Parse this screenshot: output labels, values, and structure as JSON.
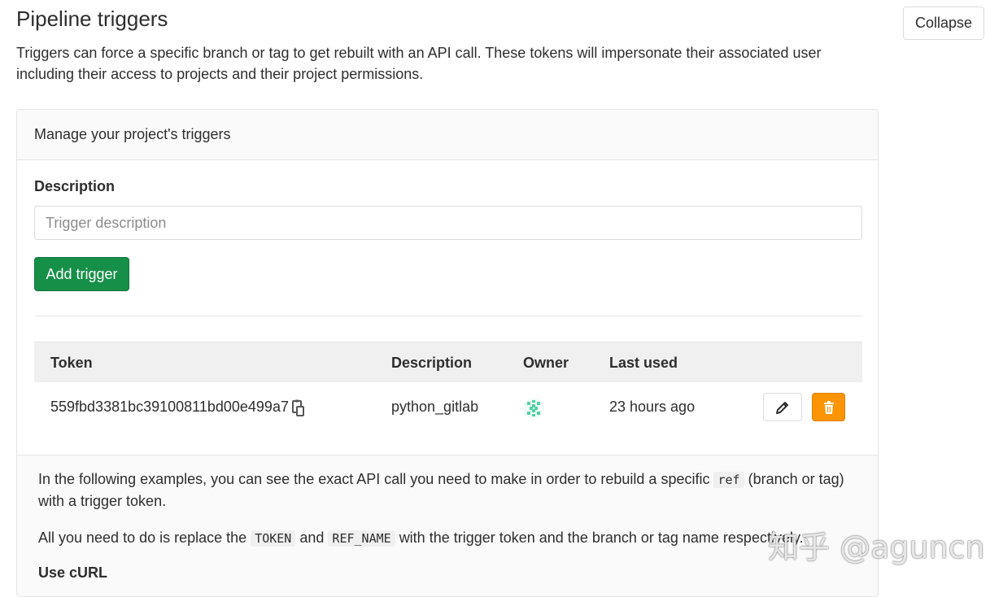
{
  "page": {
    "title": "Pipeline triggers",
    "collapse_label": "Collapse",
    "intro": "Triggers can force a specific branch or tag to get rebuilt with an API call. These tokens will impersonate their associated user including their access to projects and their project permissions."
  },
  "card": {
    "header": "Manage your project's triggers",
    "description_label": "Description",
    "description_placeholder": "Trigger description",
    "description_value": "",
    "add_button": "Add trigger"
  },
  "table": {
    "headers": {
      "token": "Token",
      "description": "Description",
      "owner": "Owner",
      "last_used": "Last used"
    },
    "rows": [
      {
        "token": "559fbd3381bc39100811bd00e499a7",
        "description": "python_gitlab",
        "owner_avatar": "identicon-avatar",
        "last_used": "23 hours ago"
      }
    ]
  },
  "footer": {
    "p1_a": "In the following examples, you can see the exact API call you need to make in order to rebuild a specific",
    "p1_code": "ref",
    "p1_b": "(branch or tag) with a trigger token.",
    "p2_a": "All you need to do is replace the",
    "p2_code1": "TOKEN",
    "p2_mid": "and",
    "p2_code2": "REF_NAME",
    "p2_b": "with the trigger token and the branch or tag name respectively.",
    "use_curl": "Use cURL"
  },
  "watermark": "知乎 @aguncn",
  "colors": {
    "primary_green": "#168f48",
    "warning_orange": "#fc9403",
    "avatar_green": "#4fd1a1"
  }
}
